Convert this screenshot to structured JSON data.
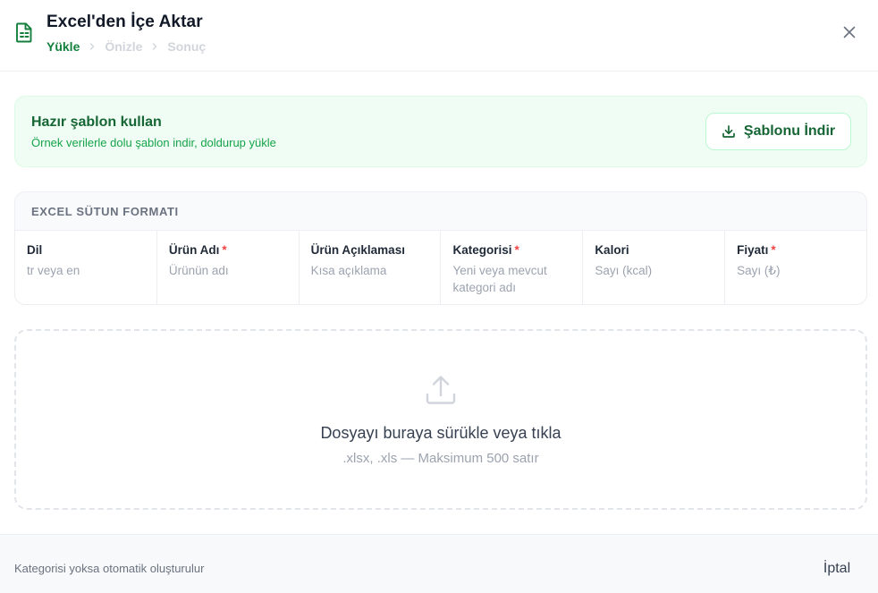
{
  "header": {
    "title": "Excel'den İçe Aktar",
    "steps": [
      "Yükle",
      "Önizle",
      "Sonuç"
    ],
    "active_step": 0,
    "icons": {
      "file": "spreadsheet-file-icon",
      "close": "close-icon"
    }
  },
  "template": {
    "title": "Hazır şablon kullan",
    "subtitle": "Örnek verilerle dolu şablon indir, doldurup yükle",
    "download_label": "Şablonu İndir",
    "download_icon": "download-icon"
  },
  "format": {
    "heading": "EXCEL SÜTUN FORMATI",
    "columns": [
      {
        "name": "Dil",
        "required": false,
        "desc": "tr veya en"
      },
      {
        "name": "Ürün Adı",
        "required": true,
        "desc": "Ürünün adı"
      },
      {
        "name": "Ürün Açıklaması",
        "required": false,
        "desc": "Kısa açıklama"
      },
      {
        "name": "Kategorisi",
        "required": true,
        "desc": "Yeni veya mevcut kategori adı"
      },
      {
        "name": "Kalori",
        "required": false,
        "desc": "Sayı (kcal)"
      },
      {
        "name": "Fiyatı",
        "required": true,
        "desc": "Sayı (₺)"
      }
    ],
    "required_marker": "*"
  },
  "dropzone": {
    "title": "Dosyayı buraya sürükle veya tıkla",
    "subtitle": ".xlsx, .xls — Maksimum 500 satır",
    "icon": "upload-icon"
  },
  "footer": {
    "note": "Kategorisi yoksa otomatik oluşturulur",
    "cancel_label": "İptal"
  },
  "colors": {
    "accent_green": "#15803d",
    "template_bg": "#f0fdf4",
    "required_red": "#ef4444"
  }
}
